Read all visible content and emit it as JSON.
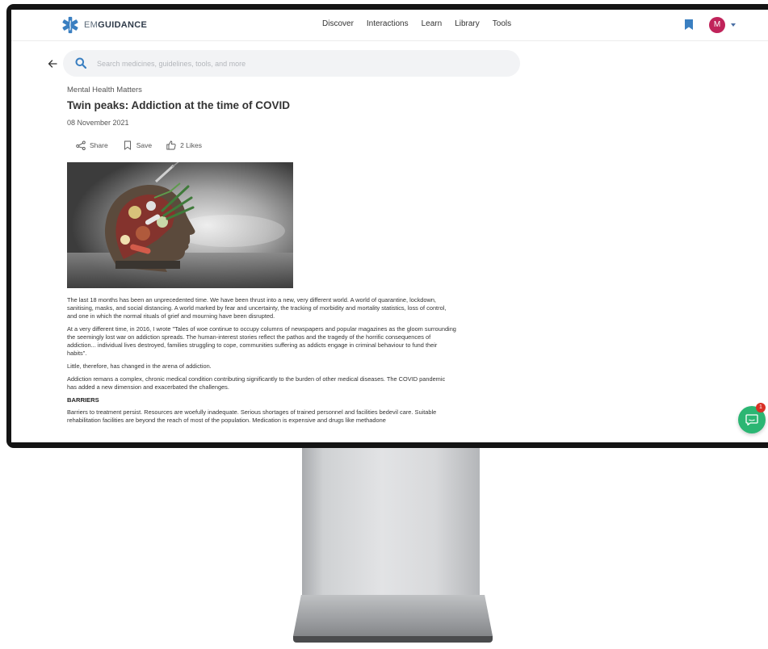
{
  "header": {
    "logo_prefix": "EM",
    "logo_suffix": "GUIDANCE",
    "nav": [
      "Discover",
      "Interactions",
      "Learn",
      "Library",
      "Tools"
    ],
    "avatar_letter": "M"
  },
  "search": {
    "placeholder": "Search medicines, guidelines, tools, and more"
  },
  "article": {
    "category": "Mental Health Matters",
    "title": "Twin peaks: Addiction at the time of COVID",
    "date": "08 November 2021",
    "actions": {
      "share": "Share",
      "save": "Save",
      "likes": "2 Likes"
    },
    "paragraphs": [
      "The last 18 months has been an unprecedented time. We have been thrust into a new, very different world. A world of quarantine, lockdown, sanitising, masks, and social distancing. A world marked by fear and uncertainty, the tracking of morbidity and mortality statistics, loss of control, and one in which the normal rituals of grief and mourning have been disrupted.",
      "At a very different time, in 2016, I wrote \"Tales of woe continue to occupy columns of newspapers and popular magazines as the gloom surrounding the seemingly lost war on addiction spreads. The human-interest stories reflect the pathos and the tragedy of the horrific consequences of addiction... individual lives destroyed, families struggling to cope, communities suffering as addicts engage in criminal behaviour to fund their habits\".",
      "Little, therefore, has changed in the arena of addiction.",
      "Addiction remans a complex, chronic medical condition contributing significantly to the burden of other medical diseases. The COVID pandemic has added a new dimension and exacerbated the challenges."
    ],
    "section_heading": "BARRIERS",
    "section_paragraph": "Barriers to treatment persist. Resources are woefully inadequate. Serious shortages of trained personnel and facilities bedevil care. Suitable rehabilitation facilities are beyond the reach of most of the population. Medication is expensive and drugs like methadone"
  },
  "chat": {
    "badge_count": "1"
  },
  "colors": {
    "brand_blue": "#3a7fc1",
    "avatar": "#c0235a",
    "chat": "#2bb673",
    "badge": "#d93025"
  }
}
